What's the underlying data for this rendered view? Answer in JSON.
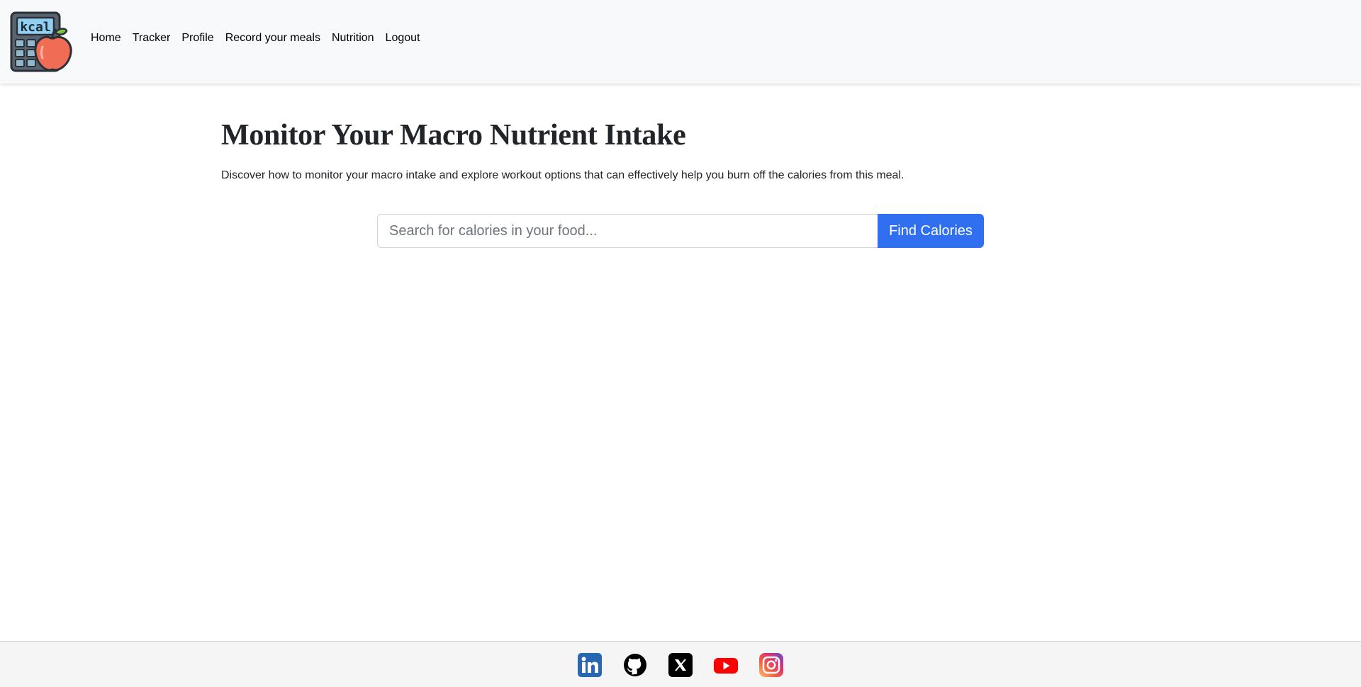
{
  "app": {
    "logo_icon": "kcal-calculator-apple-icon",
    "logo_text": "kcal"
  },
  "nav": {
    "items": [
      {
        "label": "Home"
      },
      {
        "label": "Tracker"
      },
      {
        "label": "Profile"
      },
      {
        "label": "Record your meals"
      },
      {
        "label": "Nutrition"
      },
      {
        "label": "Logout"
      }
    ]
  },
  "main": {
    "title": "Monitor Your Macro Nutrient Intake",
    "description": "Discover how to monitor your macro intake and explore workout options that can effectively help you burn off the calories from this meal."
  },
  "search": {
    "placeholder": "Search for calories in your food...",
    "value": "",
    "button_label": "Find Calories"
  },
  "footer": {
    "social": [
      {
        "icon": "linkedin-icon",
        "color": "#2867b2"
      },
      {
        "icon": "github-icon",
        "color": "#000000"
      },
      {
        "icon": "x-icon",
        "color": "#000000"
      },
      {
        "icon": "youtube-icon",
        "color": "#ff0000"
      },
      {
        "icon": "instagram-icon",
        "color": "#e1306c"
      }
    ]
  },
  "colors": {
    "accent": "#2f6ff0",
    "navbar_bg": "#f8f9fa",
    "footer_bg": "#f5f5f5"
  }
}
